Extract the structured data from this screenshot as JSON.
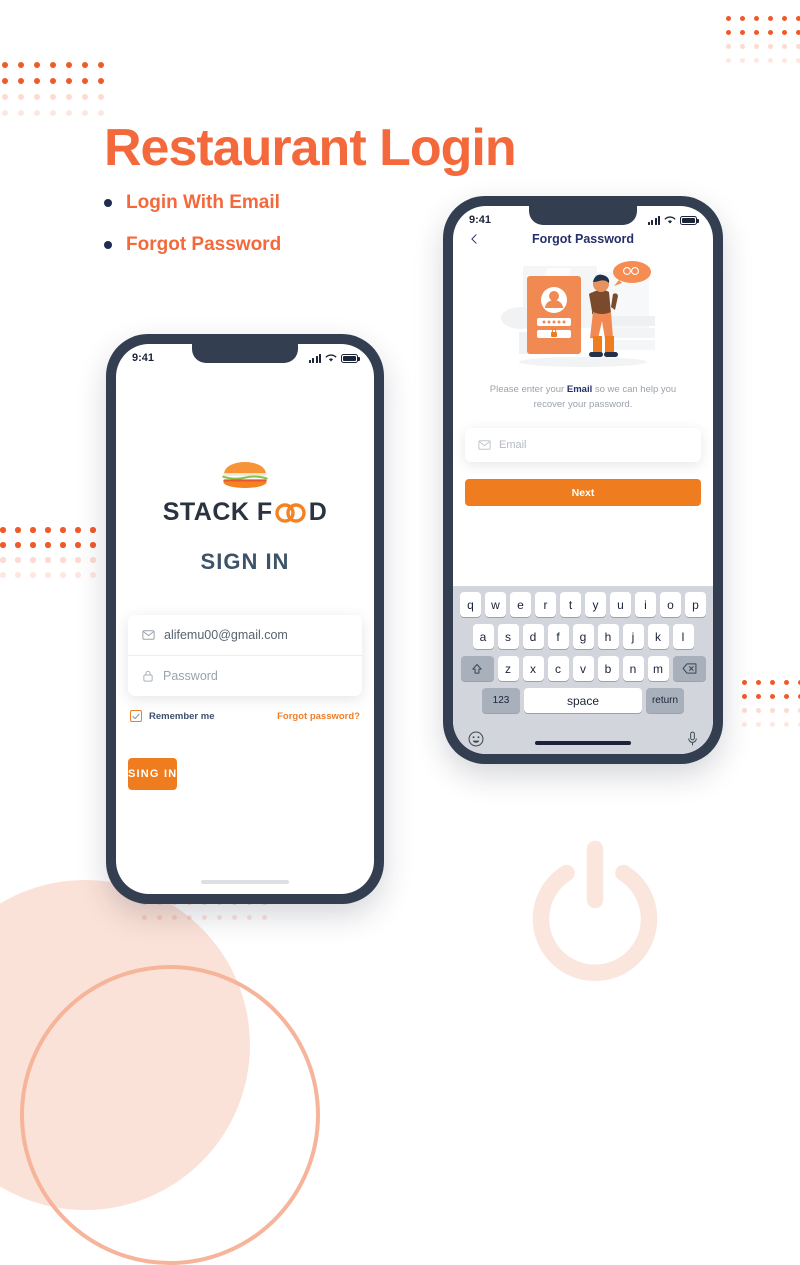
{
  "theme": {
    "accent": "#f4693b",
    "button": "#ef7d1f",
    "navy": "#262f6b",
    "dark": "#333f50",
    "pale_peach": "#fbe2d8"
  },
  "heading": {
    "title": "Restaurant Login",
    "bullets": [
      {
        "label": "Login With Email"
      },
      {
        "label": "Forgot Password"
      }
    ]
  },
  "phone_signin": {
    "status": {
      "time": "9:41",
      "signal_icon": "signal-bars-icon",
      "wifi_icon": "wifi-icon",
      "battery_icon": "battery-icon"
    },
    "logo": {
      "brand_prefix": "STACK F",
      "brand_suffix": "D",
      "burger_icon": "burger-logo-icon"
    },
    "title": "SIGN IN",
    "email_field": {
      "icon": "envelope-icon",
      "value": "alifemu00@gmail.com"
    },
    "password_field": {
      "icon": "lock-icon",
      "placeholder": "Password"
    },
    "remember": {
      "label": "Remember me",
      "checked": true,
      "check_icon": "checkmark-icon"
    },
    "forgot_link": "Forgot password?",
    "submit_label": "SING IN"
  },
  "phone_forgot": {
    "status": {
      "time": "9:41",
      "signal_icon": "signal-bars-icon",
      "wifi_icon": "wifi-icon",
      "battery_icon": "battery-icon"
    },
    "back_icon": "back-chevron-icon",
    "title": "Forgot Password",
    "illustration": "forgot-password-illustration",
    "helper_prefix": "Please enter your ",
    "helper_bold": "Email",
    "helper_suffix": " so we can help you recover your password.",
    "email_field": {
      "icon": "envelope-icon",
      "placeholder": "Email"
    },
    "next_label": "Next",
    "keyboard": {
      "row1": [
        "q",
        "w",
        "e",
        "r",
        "t",
        "y",
        "u",
        "i",
        "o",
        "p"
      ],
      "row2": [
        "a",
        "s",
        "d",
        "f",
        "g",
        "h",
        "j",
        "k",
        "l"
      ],
      "row3": [
        "z",
        "x",
        "c",
        "v",
        "b",
        "n",
        "m"
      ],
      "shift_icon": "shift-key-icon",
      "backspace_icon": "backspace-key-icon",
      "numbers_label": "123",
      "space_label": "space",
      "return_label": "return",
      "emoji_icon": "emoji-key-icon",
      "mic_icon": "microphone-key-icon"
    }
  },
  "decor": {
    "power_icon": "power-symbol-watermark",
    "dot_grids": "dot-grid-pattern",
    "circles": "peach-circle-decoration"
  }
}
